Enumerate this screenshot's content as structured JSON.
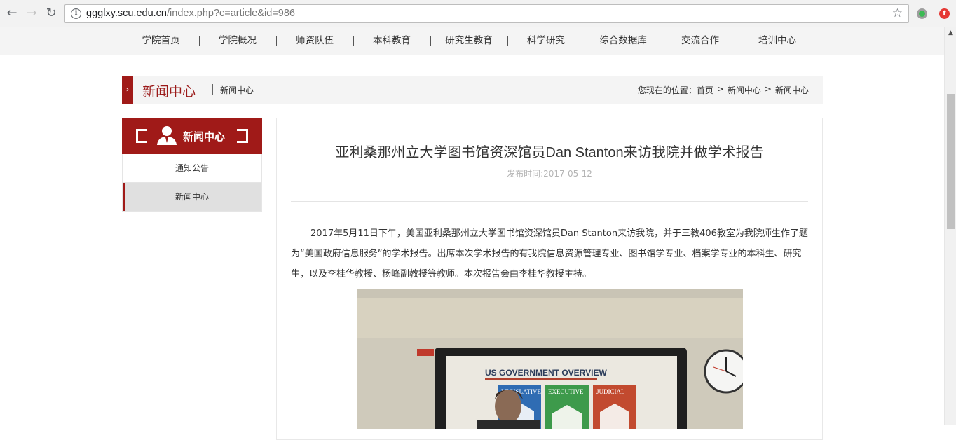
{
  "browser": {
    "url_host": "ggglxy.scu.edu.cn",
    "url_path": "/index.php?c=article&id=986"
  },
  "site_nav": {
    "items": [
      "学院首页",
      "学院概况",
      "师资队伍",
      "本科教育",
      "研究生教育",
      "科学研究",
      "综合数据库",
      "交流合作",
      "培训中心"
    ]
  },
  "channel": {
    "title": "新闻中心",
    "subtitle": "新闻中心",
    "breadcrumb_prefix": "您现在的位置：",
    "breadcrumb": [
      "首页",
      ">",
      "新闻中心",
      ">",
      "新闻中心"
    ]
  },
  "sidebar": {
    "title": "新闻中心",
    "items": [
      {
        "label": "通知公告",
        "active": false
      },
      {
        "label": "新闻中心",
        "active": true
      }
    ]
  },
  "article": {
    "title": "亚利桑那州立大学图书馆资深馆员Dan Stanton来访我院并做学术报告",
    "date": "发布时间:2017-05-12",
    "body": "2017年5月11日下午，美国亚利桑那州立大学图书馆资深馆员Dan Stanton来访我院，并于三教406教室为我院师生作了题为“美国政府信息服务”的学术报告。出席本次学术报告的有我院信息资源管理专业、图书馆学专业、档案学专业的本科生、研究生，以及李桂华教授、杨峰副教授等教师。本次报告会由李桂华教授主持。",
    "photo": {
      "slide_title": "US GOVERNMENT OVERVIEW",
      "slide_panels": [
        "LEGISLATIVE",
        "EXECUTIVE",
        "JUDICIAL"
      ]
    }
  },
  "colors": {
    "brand": "#a01a18",
    "nav_bg": "#f4f4f4"
  }
}
